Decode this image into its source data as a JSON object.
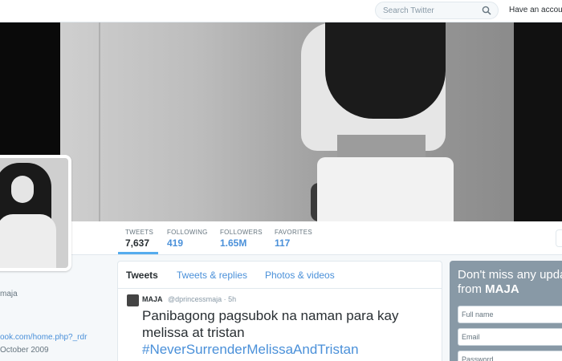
{
  "search": {
    "placeholder": "Search Twitter",
    "icon": "search-icon"
  },
  "topbar": {
    "have_account": "Have an account?"
  },
  "stats": [
    {
      "label": "TWEETS",
      "value": "7,637"
    },
    {
      "label": "FOLLOWING",
      "value": "419"
    },
    {
      "label": "FOLLOWERS",
      "value": "1.65M"
    },
    {
      "label": "FAVORITES",
      "value": "117"
    }
  ],
  "sidebar": {
    "handle_fragment": "maja",
    "link_fragment": "ook.com/home.php?_rdr",
    "joined_fragment": "October 2009"
  },
  "timeline": {
    "tabs": [
      "Tweets",
      "Tweets & replies",
      "Photos & videos"
    ],
    "tweet": {
      "name": "MAJA",
      "handle_time": "@dprincessmaja · 5h",
      "text": "Panibagong pagsubok na naman para kay melissa at tristan",
      "hashtag": "#NeverSurrenderMelissaAndTristan"
    }
  },
  "signup": {
    "title_prefix": "Don't miss any updates from",
    "title_name": "MAJA",
    "fields": {
      "full_name": "Full name",
      "email": "Email",
      "password": "Password"
    }
  },
  "colors": {
    "accent": "#4a90d9",
    "tab_underline": "#55acee",
    "signup_bg": "#8899a6"
  }
}
